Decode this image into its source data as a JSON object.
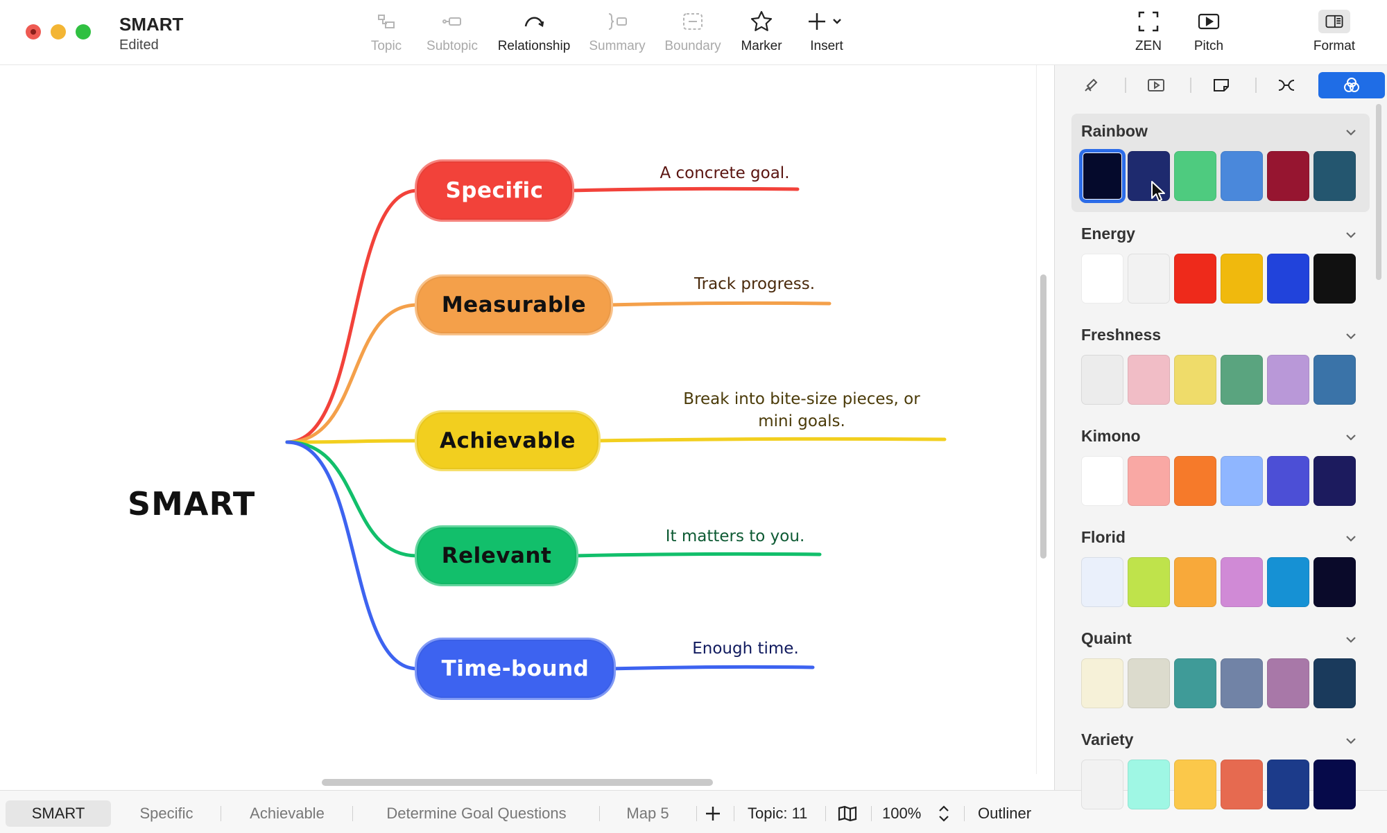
{
  "window": {
    "title": "SMART",
    "status": "Edited"
  },
  "toolbar": {
    "items": [
      {
        "label": "Topic",
        "icon": "topic-icon",
        "enabled": false
      },
      {
        "label": "Subtopic",
        "icon": "subtopic-icon",
        "enabled": false
      },
      {
        "label": "Relationship",
        "icon": "relationship-icon",
        "enabled": true
      },
      {
        "label": "Summary",
        "icon": "summary-icon",
        "enabled": false
      },
      {
        "label": "Boundary",
        "icon": "boundary-icon",
        "enabled": false
      },
      {
        "label": "Marker",
        "icon": "star-icon",
        "enabled": true
      },
      {
        "label": "Insert",
        "icon": "plus-icon",
        "enabled": true
      }
    ],
    "right": [
      {
        "label": "ZEN",
        "icon": "fullscreen-icon"
      },
      {
        "label": "Pitch",
        "icon": "play-icon"
      },
      {
        "label": "Format",
        "icon": "sidebar-icon"
      }
    ]
  },
  "map": {
    "root": "SMART",
    "branches": [
      {
        "label": "Specific",
        "note": "A concrete goal.",
        "color": "#f2423a",
        "text_color": "#ffffff",
        "note_color": "#5a1410"
      },
      {
        "label": "Measurable",
        "note": "Track progress.",
        "color": "#f4a04a",
        "text_color": "#111111",
        "note_color": "#4a2a0c"
      },
      {
        "label": "Achievable",
        "note": "Break into bite-size pieces, or mini goals.",
        "color": "#f2cf1f",
        "text_color": "#111111",
        "note_color": "#4a3a08"
      },
      {
        "label": "Relevant",
        "note": "It matters to you.",
        "color": "#12bf6b",
        "text_color": "#111111",
        "note_color": "#0d5a33"
      },
      {
        "label": "Time-bound",
        "note": "Enough time.",
        "color": "#3d63f0",
        "text_color": "#ffffff",
        "note_color": "#101a5e"
      }
    ]
  },
  "bottom": {
    "sheets": [
      "SMART",
      "Specific",
      "Achievable",
      "Determine Goal Questions",
      "Map 5"
    ],
    "active_sheet": "SMART",
    "topic_count": "Topic: 11",
    "zoom": "100%",
    "outliner": "Outliner"
  },
  "panel": {
    "tabs": [
      "style-icon",
      "pitch-icon",
      "sticker-icon",
      "layout-icon",
      "theme-color-icon"
    ],
    "active_tab": 4,
    "themes": [
      {
        "name": "Rainbow",
        "colors": [
          "#050a2c",
          "#1e2a6e",
          "#4ecb7f",
          "#4a88db",
          "#961530",
          "#24566f"
        ],
        "selected": true
      },
      {
        "name": "Energy",
        "colors": [
          "#ffffff",
          "#f2f2f2",
          "#ee2a1b",
          "#f0b90d",
          "#2143db",
          "#111111"
        ]
      },
      {
        "name": "Freshness",
        "colors": [
          "#ececec",
          "#f1bdc6",
          "#efdc6a",
          "#5aa47f",
          "#b998d8",
          "#3a73a8"
        ]
      },
      {
        "name": "Kimono",
        "colors": [
          "#ffffff",
          "#f9a8a4",
          "#f67a2a",
          "#8fb6ff",
          "#4c4fd6",
          "#1c1b5e"
        ]
      },
      {
        "name": "Florid",
        "colors": [
          "#eaf0fb",
          "#bfe34b",
          "#f8a93a",
          "#d08ad6",
          "#1691d4",
          "#0a0a2a"
        ]
      },
      {
        "name": "Quaint",
        "colors": [
          "#f6f1d8",
          "#dcdbcd",
          "#3f9b98",
          "#7183a6",
          "#a878a8",
          "#1a3a5c"
        ]
      },
      {
        "name": "Variety",
        "colors": [
          "#f2f2f2",
          "#9ff7e4",
          "#fbc84a",
          "#e66a50",
          "#1c3b8a",
          "#060a4a"
        ]
      }
    ]
  }
}
